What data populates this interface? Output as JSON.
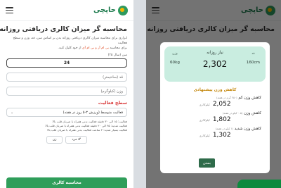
{
  "app": {
    "logo_text": "حاپچی"
  },
  "form": {
    "title": "محاسبه گر میزان کالری دریافتی روزانه",
    "desc_line1": "ابزاری برای محاسبه میزان کالری دریافتی روزانه بدن بر اساس سن، قد، وزن و سطح فعالیت",
    "desc_line2_pre": "برای محاسبه ",
    "desc_highlight": "بی ام آر و بی ام آی",
    "desc_line2_post": " از خود کلیک کنید.",
    "age_label": "سن (سال ۲۵)",
    "age_value": "24",
    "height_placeholder": "قد (سانتیمتر)",
    "weight_placeholder": "وزن (کیلوگرم)",
    "activity_title": "سطح فعالیت",
    "activity_selected": "فعالیت متوسط (ورزش ۳-۵ روز در هفته)",
    "activity_notes": [
      "فعالیت: ۱۵ الی ۳۰ دقیقه فعالیت بدنی همراه با ضربان قلب بالا",
      "فعالیت شدید: ۴۵ الی ۲۰ دقیقه فعالیت بدنی همراه با ضربان قلب بالا",
      "فعالیت بسیار شدید: ۲ ساعت فعالیت بدنی همراه با ضربان قلب بالا"
    ],
    "gender_male": "♂ مرد",
    "gender_female": "زن",
    "calculate_button": "محاسبه کالری"
  },
  "result": {
    "weight_label": "وزن",
    "weight_value": "60kg",
    "height_label": "قد",
    "height_value": "160cm",
    "need_label": "نیاز روزانه",
    "need_value": "2,302",
    "suggestion_title": "کاهش وزن پیشنهادی",
    "suggestion_main": "کاهش وزن پیشنهادی",
    "options": [
      {
        "name": "کاهش وزن کم",
        "sub": "(۲۵۰ گرم در هفته)",
        "value": "2,052",
        "unit": "کیلوکالری"
      },
      {
        "name": "کاهش وزن",
        "sub": "(۰.۵ کیلو در هفته)",
        "value": "1,802",
        "unit": "کیلوکالری"
      },
      {
        "name": "کاهش وزن شدید",
        "sub": "(۱ کیلو در هفته)",
        "value": "1,302",
        "unit": "کیلوکالری"
      }
    ],
    "close_button": "بستن"
  },
  "colors": {
    "brand_green": "#2f9e5a",
    "accent_red": "#d94141",
    "card_mint": "#c9ede0",
    "accent_gold": "#c58a12"
  }
}
